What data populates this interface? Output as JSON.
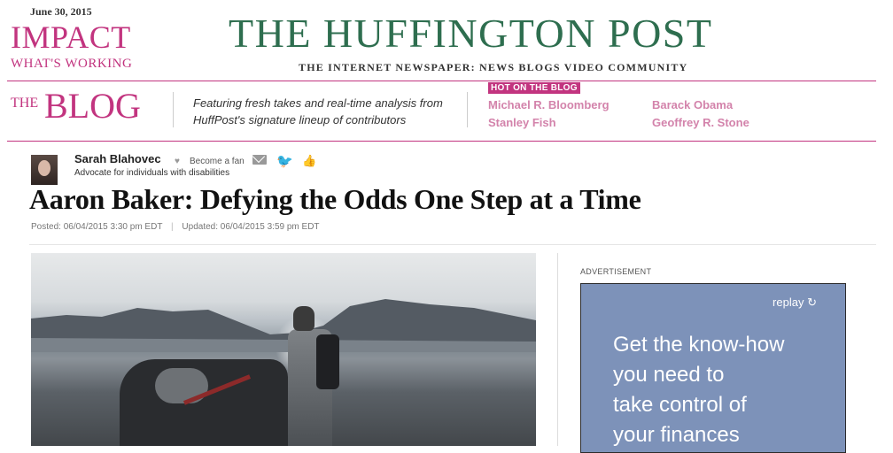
{
  "edition": {
    "date": "June 30, 2015",
    "section_title": "IMPACT",
    "section_subtitle": "WHAT'S WORKING"
  },
  "masthead": {
    "title": "THE HUFFINGTON POST",
    "tagline": "THE INTERNET NEWSPAPER: NEWS BLOGS VIDEO COMMUNITY"
  },
  "blog_bar": {
    "the": "THE",
    "blog": "BLOG",
    "featuring": "Featuring fresh takes and real-time analysis from HuffPost's signature lineup of contributors",
    "hot_label": "HOT ON THE BLOG",
    "hot_links": [
      "Michael R. Bloomberg",
      "Barack Obama",
      "Stanley Fish",
      "Geoffrey R. Stone"
    ]
  },
  "author": {
    "name": "Sarah Blahovec",
    "bio": "Advocate for individuals with disabilities",
    "become_fan": "Become a fan"
  },
  "article": {
    "headline": "Aaron Baker: Defying the Odds One Step at a Time",
    "posted": "Posted: 06/04/2015  3:30 pm EDT",
    "updated": "Updated: 06/04/2015  3:59 pm EDT"
  },
  "sidebar": {
    "ad_label": "ADVERTISEMENT",
    "ad_replay": "replay",
    "ad_lines": [
      "Get the know-how",
      "you need to",
      "take control of",
      "your finances"
    ],
    "ad_color": "#7d92b9"
  },
  "colors": {
    "accent": "#c2347f",
    "masthead": "#2e6e4f",
    "hot_link": "#d383ab"
  }
}
